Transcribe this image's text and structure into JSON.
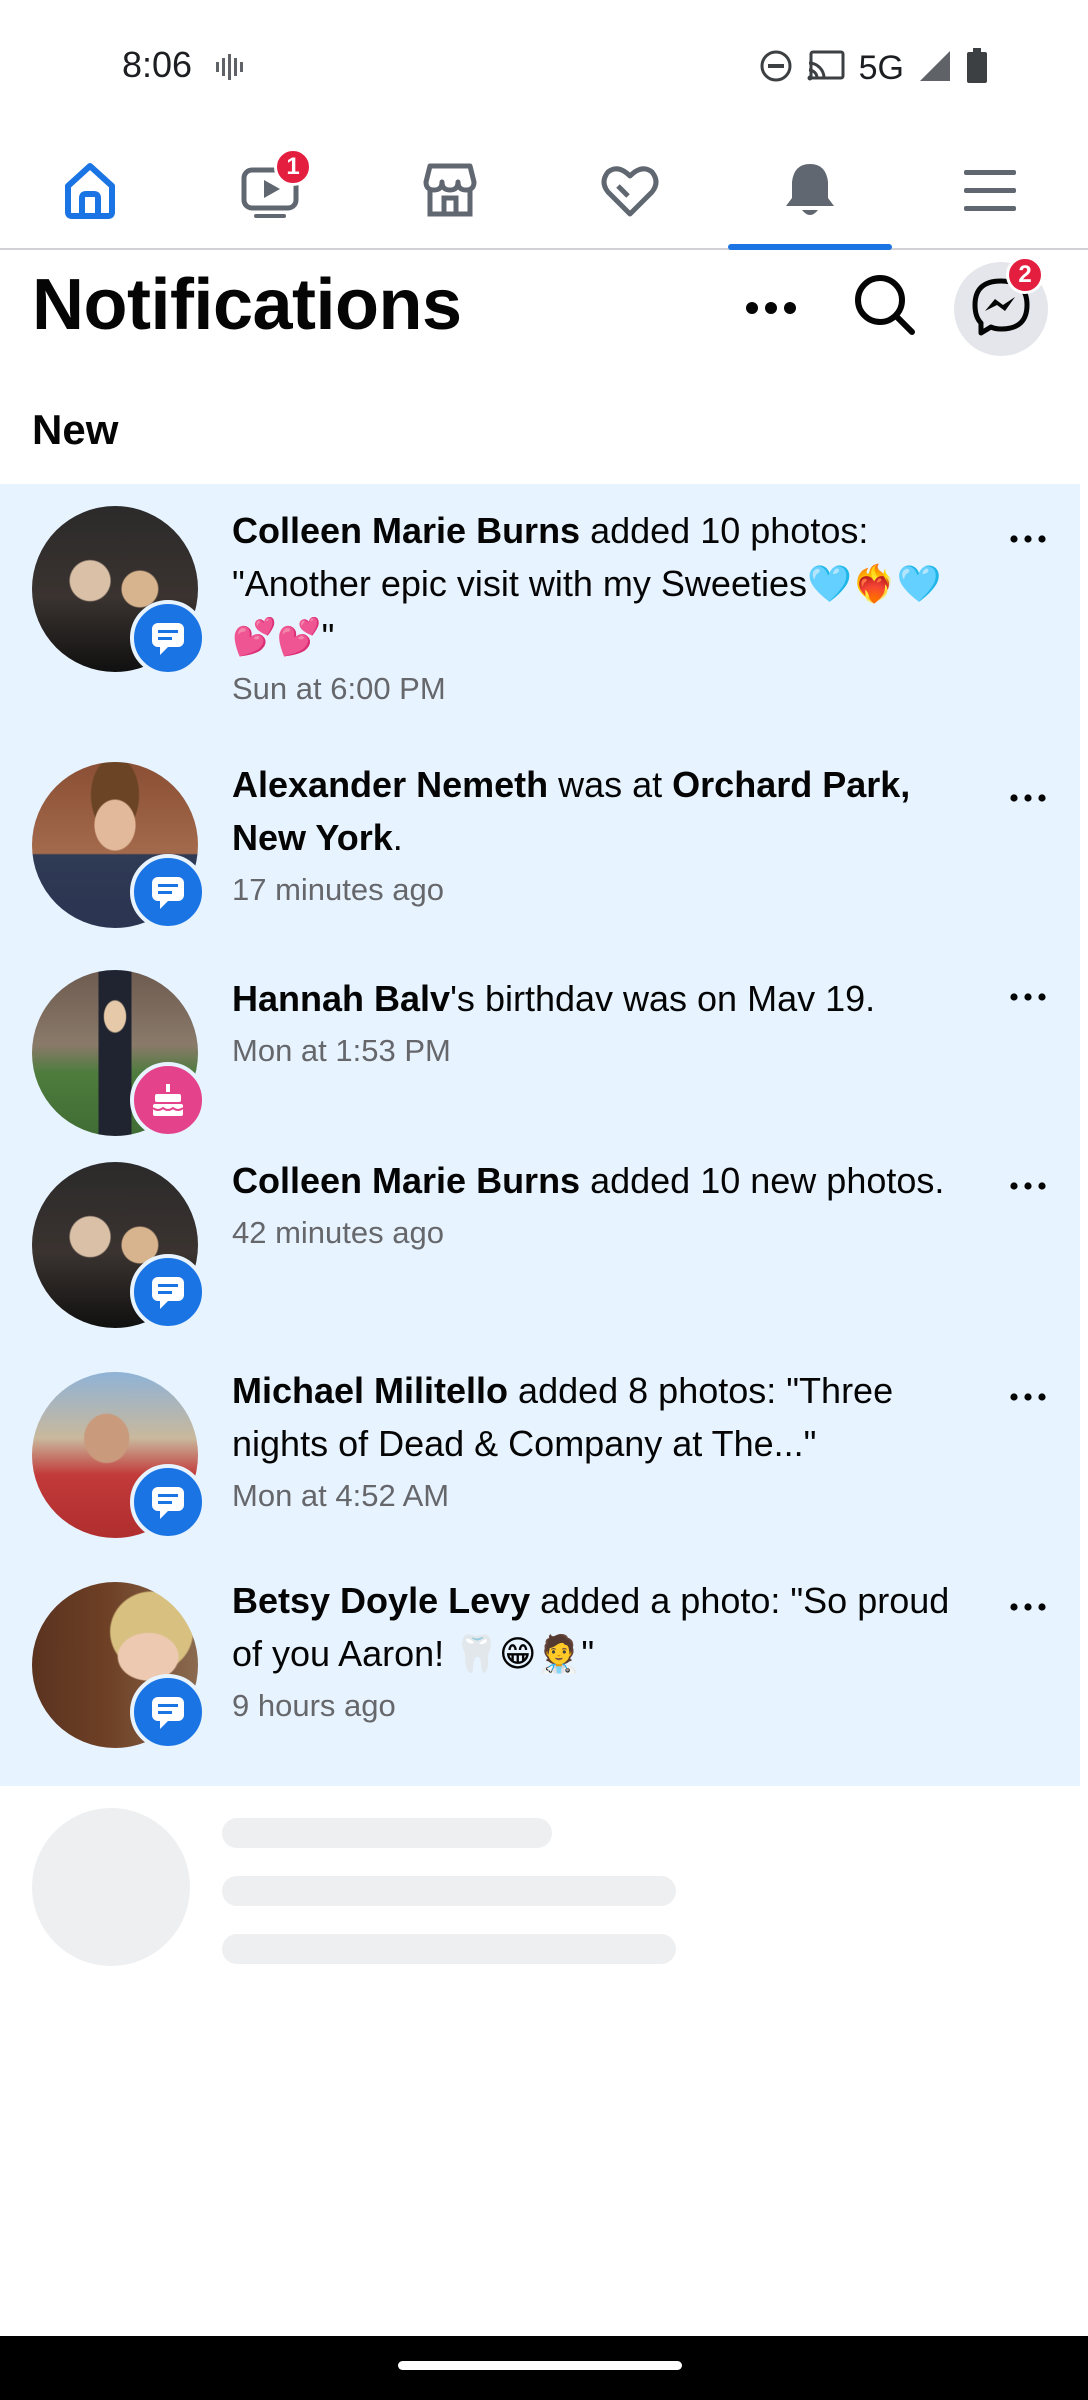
{
  "status_bar": {
    "time": "8:06",
    "network": "5G",
    "icons": [
      "vibrate-icon",
      "do-not-disturb-icon",
      "cast-icon",
      "signal-icon",
      "battery-icon"
    ]
  },
  "tabs": [
    {
      "name": "home",
      "icon": "home-icon",
      "active": false,
      "badge": ""
    },
    {
      "name": "video",
      "icon": "video-icon",
      "active": false,
      "badge": "1"
    },
    {
      "name": "marketplace",
      "icon": "marketplace-icon",
      "active": false,
      "badge": ""
    },
    {
      "name": "dating",
      "icon": "dating-heart-icon",
      "active": false,
      "badge": ""
    },
    {
      "name": "notifications",
      "icon": "bell-icon",
      "active": true,
      "badge": ""
    },
    {
      "name": "menu",
      "icon": "menu-icon",
      "active": false,
      "badge": ""
    }
  ],
  "header": {
    "title": "Notifications",
    "messenger_badge": "2"
  },
  "section": {
    "label": "New"
  },
  "notifications": [
    {
      "name": "Colleen Marie Burns",
      "text": " added 10 photos: \"Another epic visit with my Sweeties🩵❤️‍🔥🩵💕💕\"",
      "time": "Sun at 6:00 PM",
      "badge_type": "comment-icon",
      "badge_color": "#1b74e4"
    },
    {
      "name": "Alexander Nemeth",
      "text_mid": " was at ",
      "place": "Orchard Park, New York",
      "text_end": ".",
      "time": "17 minutes ago",
      "badge_type": "comment-icon",
      "badge_color": "#1b74e4"
    },
    {
      "name": "Hannah Balv",
      "text": "'s birthdav was on Mav 19.",
      "time": "Mon at 1:53 PM",
      "badge_type": "birthday-cake-icon",
      "badge_color": "#e4428b"
    },
    {
      "name": "Colleen Marie Burns",
      "text": " added 10 new photos.",
      "time": "42 minutes ago",
      "badge_type": "comment-icon",
      "badge_color": "#1b74e4"
    },
    {
      "name": "Michael Militello",
      "text": " added 8 photos: \"Three nights of Dead & Company at The...\"",
      "time": "Mon at 4:52 AM",
      "badge_type": "comment-icon",
      "badge_color": "#1b74e4"
    },
    {
      "name": "Betsy Doyle Levy",
      "text": " added a photo: \"So proud of you Aaron! 🦷😁🧑‍⚕️\"",
      "time": "9 hours ago",
      "badge_type": "comment-icon",
      "badge_color": "#1b74e4"
    }
  ],
  "colors": {
    "accent": "#1b74e4",
    "unread_background": "#e7f3ff",
    "badge_red": "#e41e3f",
    "secondary_text": "#65676b"
  }
}
